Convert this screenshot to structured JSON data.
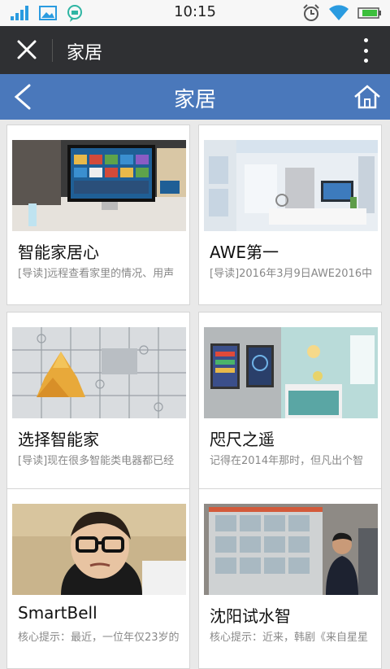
{
  "status": {
    "time": "10:15"
  },
  "titlebar": {
    "title": "家居",
    "close_icon": "close-icon",
    "menu_icon": "more-vertical-icon"
  },
  "header": {
    "title": "家居",
    "back_icon": "back-chevron-icon",
    "home_icon": "home-icon",
    "color": "#4a78bb"
  },
  "articles": [
    {
      "title": "智能家居心",
      "summary": "[导读]远程查看家里的情况、用声",
      "image": "smart-tv-image"
    },
    {
      "title": "AWE第一",
      "summary": "[导读]2016年3月9日AWE2016中",
      "image": "smart-home-exhibit-image"
    },
    {
      "title": "选择智能家",
      "summary": "[导读]现在很多智能类电器都已经",
      "image": "puzzle-image"
    },
    {
      "title": "咫尺之遥",
      "summary": "记得在2014年那时，但凡出个智",
      "image": "smart-panel-kitchen-image"
    },
    {
      "title": "SmartBell",
      "summary": "核心提示：最近，一位年仅23岁的",
      "image": "woman-glasses-image"
    },
    {
      "title": "沈阳试水智",
      "summary": "核心提示：近来，韩剧《来自星星",
      "image": "man-window-image"
    }
  ]
}
